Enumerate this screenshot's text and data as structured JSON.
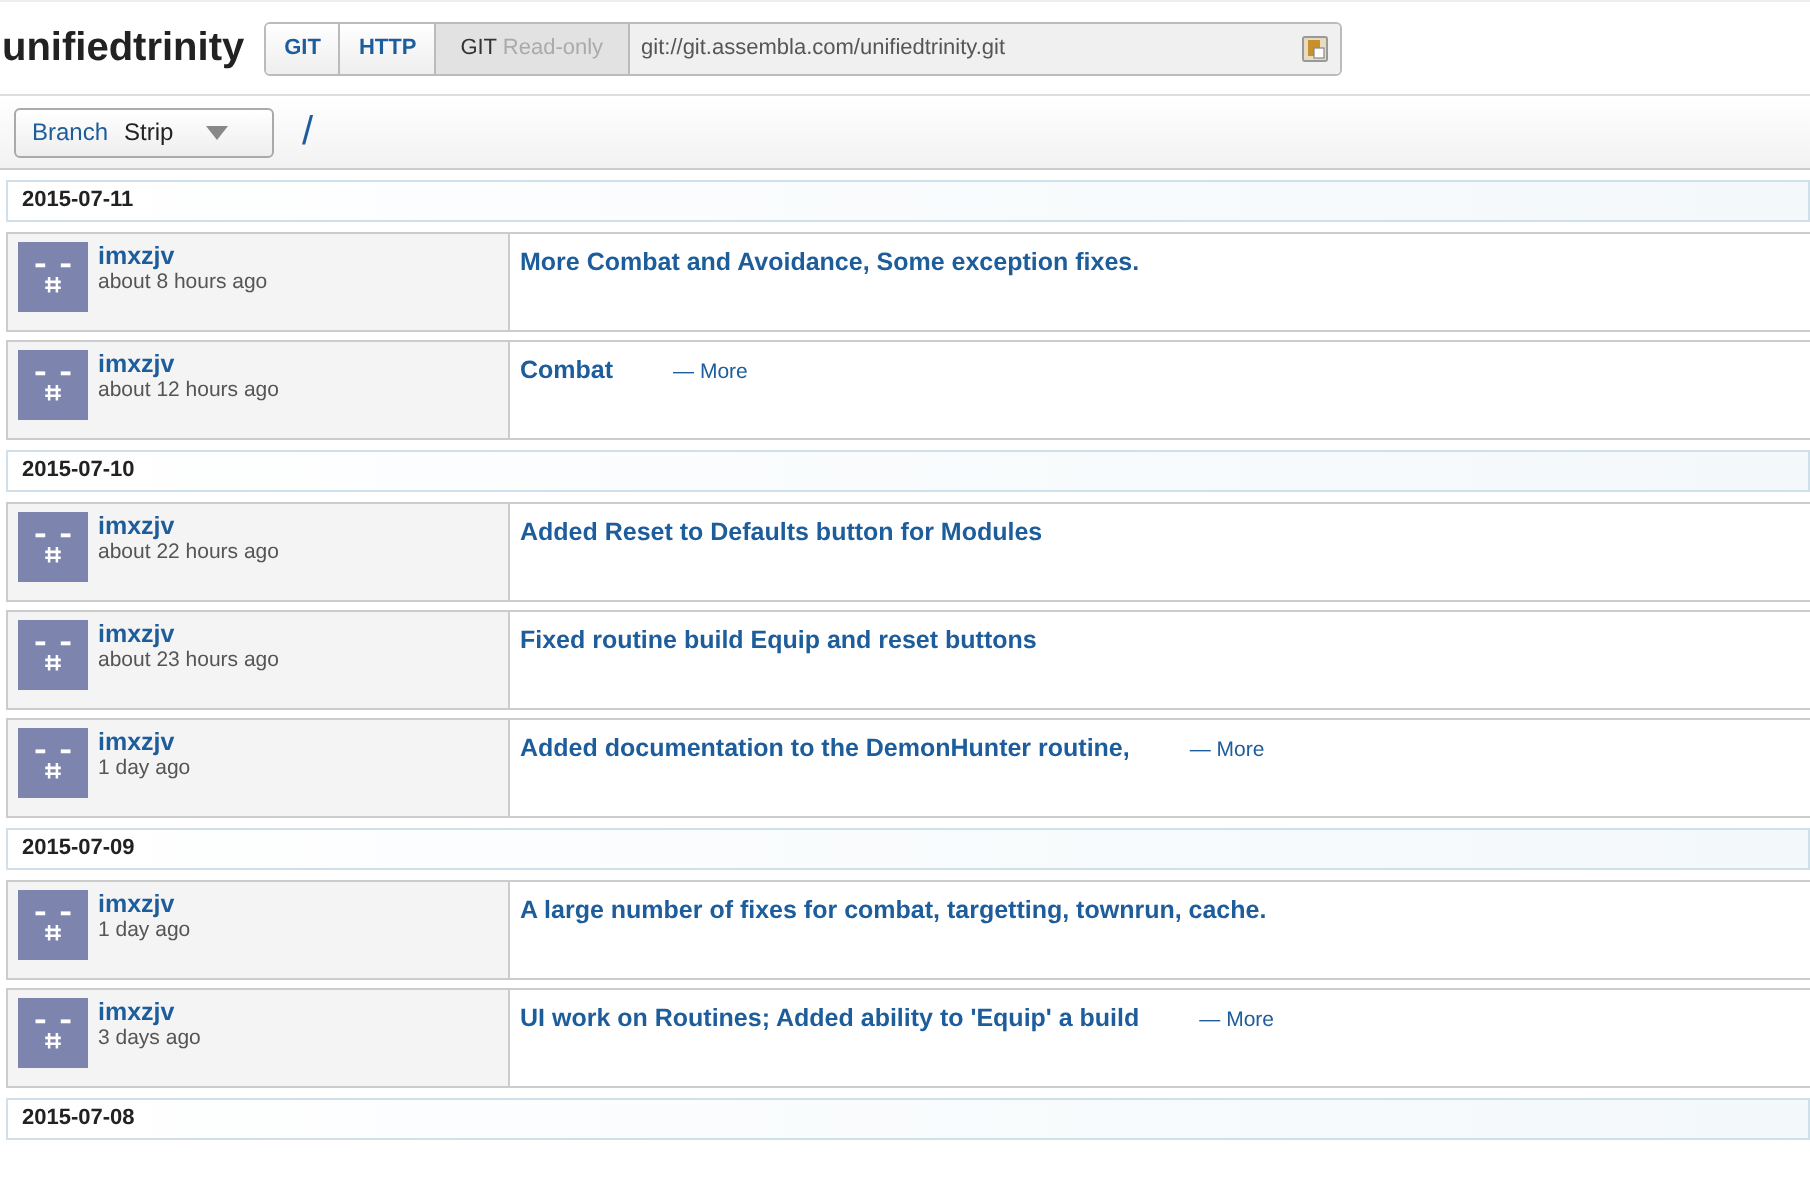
{
  "repo": {
    "title": "unifiedtrinity",
    "protocols": [
      {
        "label": "GIT",
        "selected": false
      },
      {
        "label": "HTTP",
        "selected": false
      },
      {
        "label": "GIT",
        "note": "Read-only",
        "selected": true
      }
    ],
    "url": "git://git.assembla.com/unifiedtrinity.git"
  },
  "toolbar": {
    "branch_label": "Branch",
    "branch": "Strip",
    "path": "/"
  },
  "days": [
    {
      "date": "2015-07-11",
      "commits": [
        {
          "author": "imxzjv",
          "time": "about 8 hours ago",
          "message": "More Combat and Avoidance, Some exception fixes."
        },
        {
          "author": "imxzjv",
          "time": "about 12 hours ago",
          "message": "Combat",
          "more": "— More"
        }
      ]
    },
    {
      "date": "2015-07-10",
      "commits": [
        {
          "author": "imxzjv",
          "time": "about 22 hours ago",
          "message": "Added Reset to Defaults button for Modules"
        },
        {
          "author": "imxzjv",
          "time": "about 23 hours ago",
          "message": "Fixed routine build Equip and reset buttons"
        },
        {
          "author": "imxzjv",
          "time": "1 day ago",
          "message": "Added documentation to the DemonHunter routine,",
          "more": "— More"
        }
      ]
    },
    {
      "date": "2015-07-09",
      "commits": [
        {
          "author": "imxzjv",
          "time": "1 day ago",
          "message": "A large number of fixes for combat, targetting, townrun, cache."
        },
        {
          "author": "imxzjv",
          "time": "3 days ago",
          "message": "UI work on Routines; Added ability to 'Equip' a build",
          "more": "— More"
        }
      ]
    },
    {
      "date": "2015-07-08"
    }
  ]
}
